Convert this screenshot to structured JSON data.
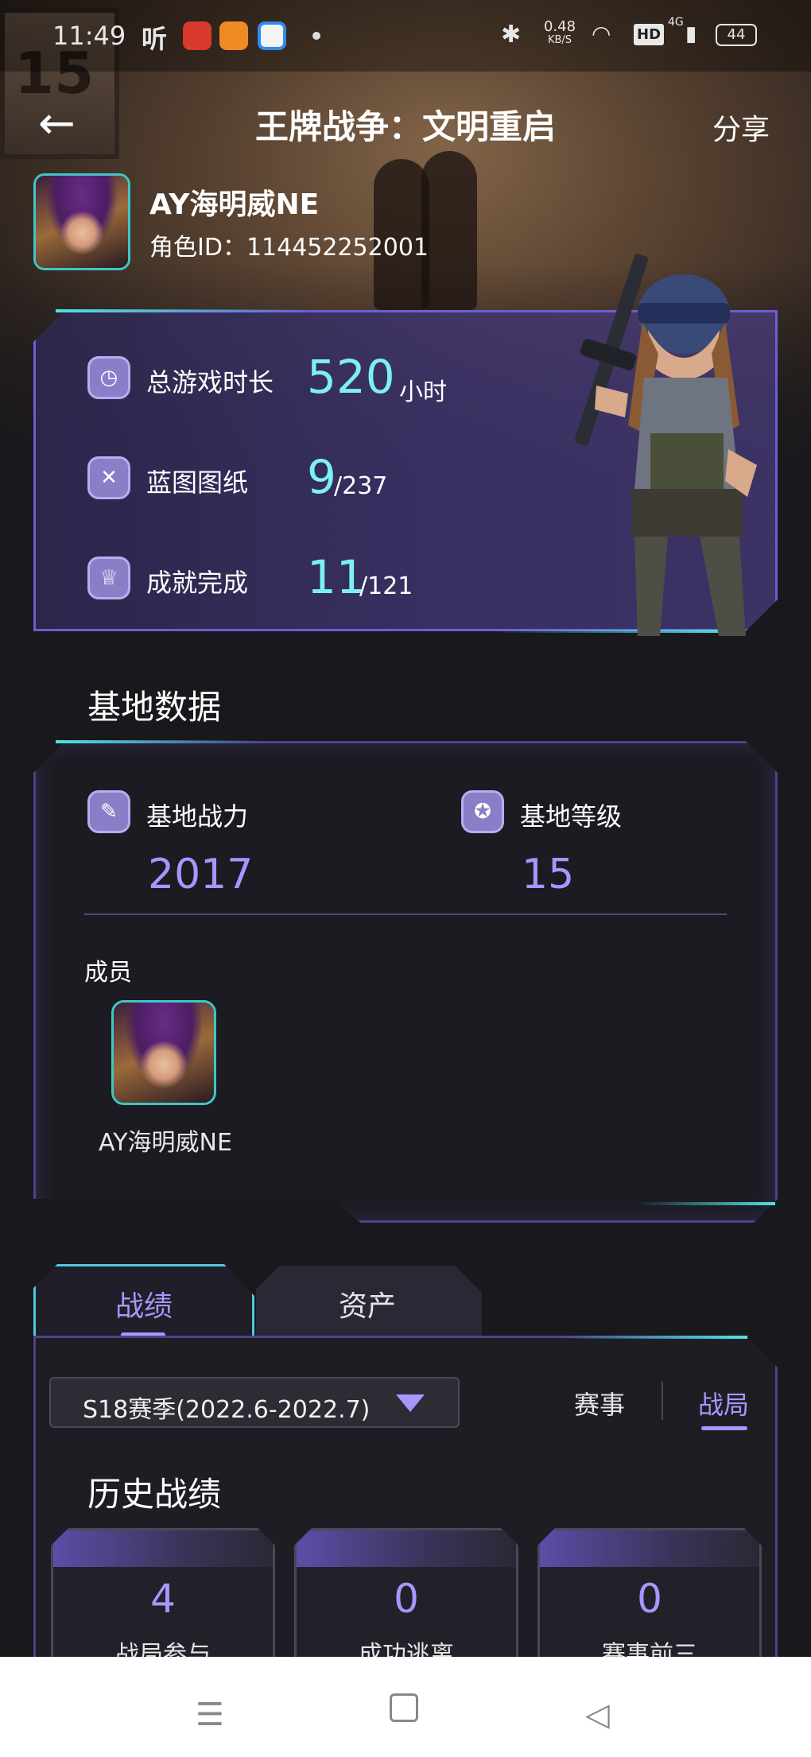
{
  "status_bar": {
    "time": "11:49",
    "app_label": "听",
    "speed_value": "0.48",
    "speed_unit": "KB/S",
    "hd": "HD",
    "network": "4G",
    "battery": "44"
  },
  "header": {
    "title": "王牌战争：文明重启",
    "share_label": "分享"
  },
  "profile": {
    "name": "AY海明威NE",
    "role_id": "角色ID：114452252001"
  },
  "stats": [
    {
      "label": "总游戏时长",
      "value": "520",
      "suffix": "小时",
      "icon": "stopwatch-icon"
    },
    {
      "label": "蓝图图纸",
      "value": "9",
      "suffix": "/237",
      "icon": "blueprint-icon"
    },
    {
      "label": "成就完成",
      "value": "11",
      "suffix": "/121",
      "icon": "trophy-icon"
    }
  ],
  "base": {
    "title": "基地数据",
    "power_label": "基地战力",
    "power_value": "2017",
    "level_label": "基地等级",
    "level_value": "15",
    "members_label": "成员",
    "member_name": "AY海明威NE"
  },
  "tabs": {
    "record": "战绩",
    "assets": "资产"
  },
  "record": {
    "season": "S18赛季(2022.6-2022.7)",
    "filter_event": "赛事",
    "filter_match": "战局",
    "history_title": "历史战绩",
    "cards": [
      {
        "value": "4",
        "label": "战局参与"
      },
      {
        "value": "0",
        "label": "成功逃离"
      },
      {
        "value": "0",
        "label": "赛事前三"
      }
    ]
  },
  "colors": {
    "accent_purple": "#a995ff",
    "accent_cyan": "#7ef0f2",
    "background": "#19181c"
  }
}
